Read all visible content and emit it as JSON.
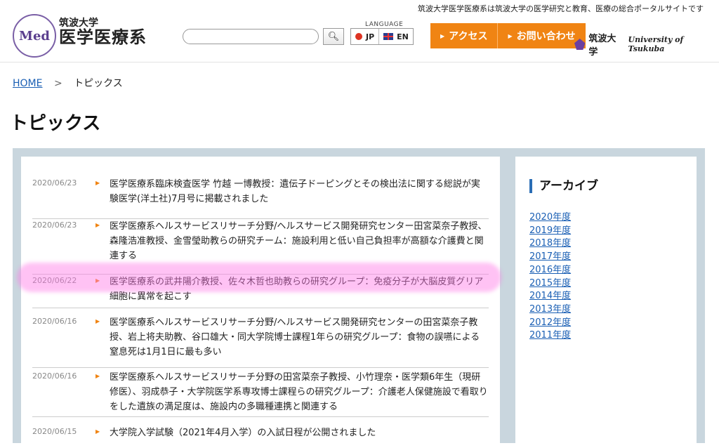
{
  "header": {
    "tagline": "筑波大学医学医療系は筑波大学の医学研究と教育、医療の総合ポータルサイトです",
    "logo_emblem_text": "Med",
    "logo_univ": "筑波大学",
    "logo_dept": "医学医療系",
    "search": {
      "placeholder": "",
      "value": ""
    },
    "language_label": "LANGUAGE",
    "languages": [
      "JP",
      "EN"
    ],
    "buttons": [
      "アクセス",
      "お問い合わせ"
    ],
    "tsukuba_jp": "筑波大学",
    "tsukuba_en": "University of Tsukuba",
    "accent_color": "#f08413"
  },
  "breadcrumb": {
    "home": "HOME",
    "current": "トピックス"
  },
  "page_title": "トピックス",
  "news": [
    {
      "date": "2020/06/23",
      "text": "医学医療系臨床検査医学 竹越 一博教授：遺伝子ドーピングとその検出法に関する総説が実験医学(洋土社)7月号に掲載されました"
    },
    {
      "date": "2020/06/23",
      "text": "医学医療系ヘルスサービスリサーチ分野/ヘルスサービス開発研究センター田宮菜奈子教授、森隆浩准教授、金雪瑩助教らの研究チーム：施設利用と低い自己負担率が高額な介護費と関連する"
    },
    {
      "date": "2020/06/22",
      "text": "医学医療系の武井陽介教授、佐々木哲也助教らの研究グループ：免疫分子が大脳皮質グリア細胞に異常を起こす"
    },
    {
      "date": "2020/06/16",
      "text": "医学医療系ヘルスサービスリサーチ分野/ヘルスサービス開発研究センターの田宮菜奈子教授、岩上将夫助教、谷口雄大・同大学院博士課程1年らの研究グループ：食物の誤嚥による窒息死は1月1日に最も多い"
    },
    {
      "date": "2020/06/16",
      "text": "医学医療系ヘルスサービスリサーチ分野の田宮菜奈子教授、小竹理奈・医学類6年生（現研修医）、羽成恭子・大学院医学系専攻博士課程らの研究グループ：介護老人保健施設で看取りをした遺族の満足度は、施設内の多職種連携と関連する"
    },
    {
      "date": "2020/06/15",
      "text": "大学院入学試験（2021年4月入学）の入試日程が公開されました"
    }
  ],
  "archive": {
    "title": "アーカイブ",
    "years": [
      "2020年度",
      "2019年度",
      "2018年度",
      "2017年度",
      "2016年度",
      "2015年度",
      "2014年度",
      "2013年度",
      "2012年度",
      "2011年度"
    ]
  }
}
